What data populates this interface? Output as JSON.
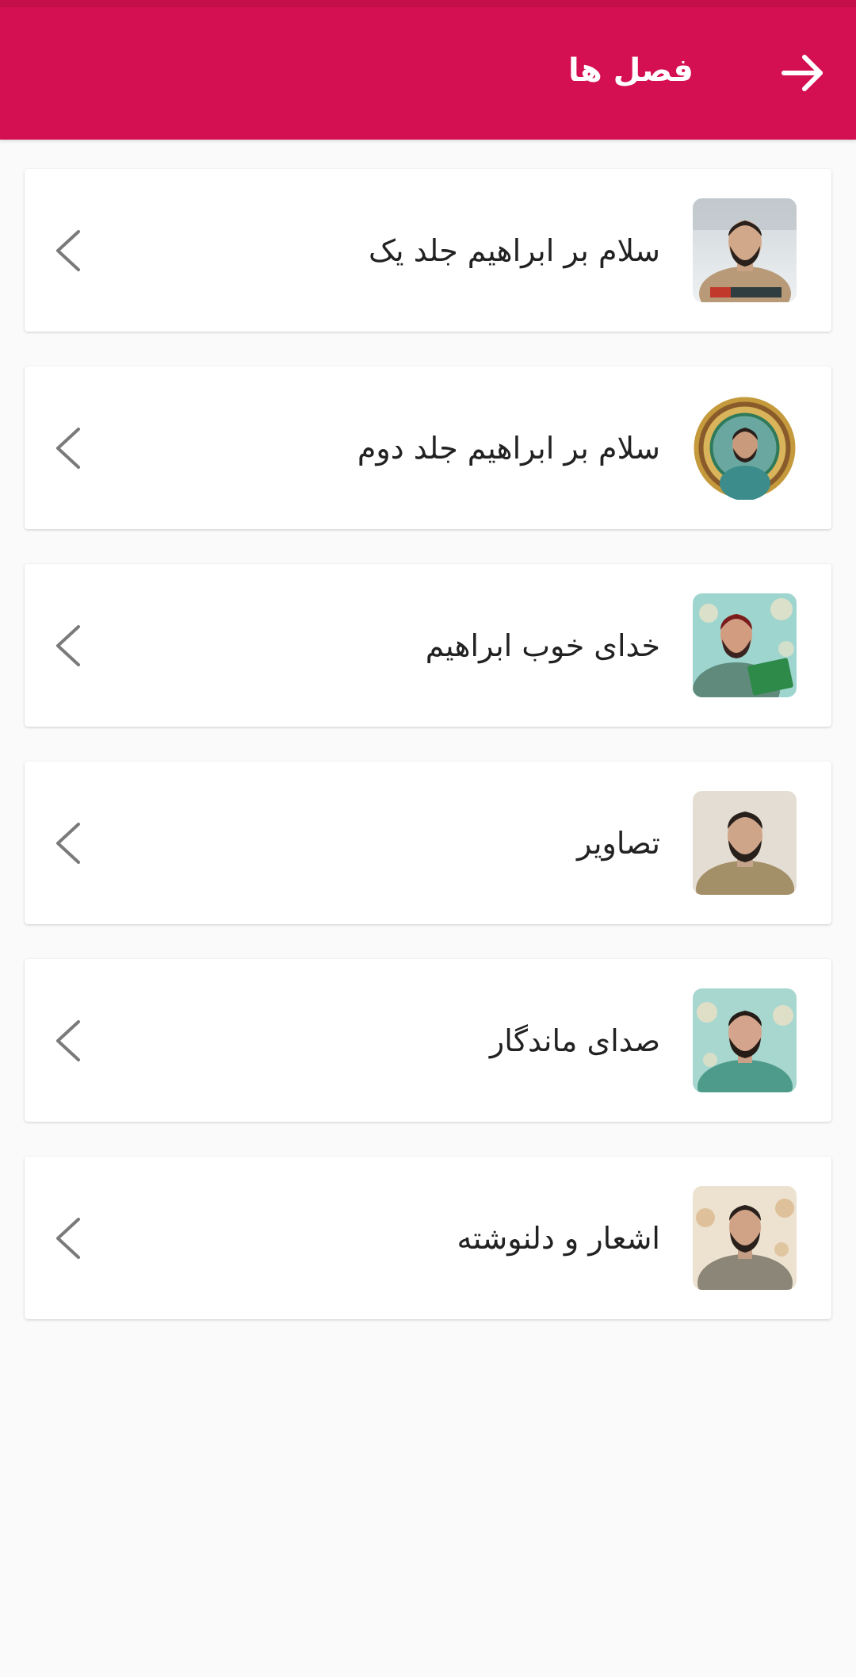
{
  "app_bar": {
    "title": "فصل ها",
    "back_icon": "arrow-right-icon",
    "color": "#d40f52"
  },
  "chapters": [
    {
      "label": "سلام بر ابراهیم جلد یک",
      "thumbnail": "portrait-book-cover"
    },
    {
      "label": "سلام بر ابراهیم جلد دوم",
      "thumbnail": "portrait-ornamental-frame"
    },
    {
      "label": "خدای خوب ابراهیم",
      "thumbnail": "portrait-reading-quran"
    },
    {
      "label": "تصاویر",
      "thumbnail": "portrait-photo"
    },
    {
      "label": "صدای ماندگار",
      "thumbnail": "portrait-floral-background"
    },
    {
      "label": "اشعار و دلنوشته",
      "thumbnail": "portrait-jacket"
    }
  ],
  "chevron_icon": "chevron-left-icon"
}
